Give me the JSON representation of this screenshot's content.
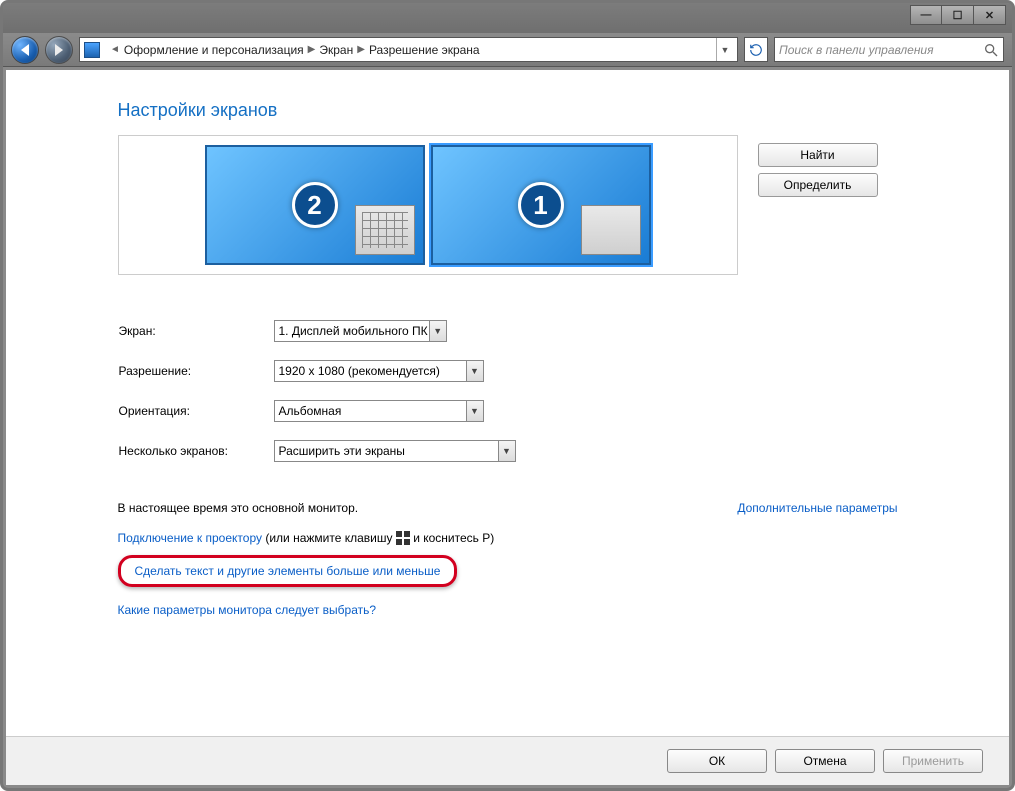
{
  "window": {
    "minimize": "—",
    "maximize": "☐",
    "close": "✕"
  },
  "nav": {
    "crumb1": "Оформление и персонализация",
    "crumb2": "Экран",
    "crumb3": "Разрешение экрана",
    "search_placeholder": "Поиск в панели управления"
  },
  "page": {
    "title": "Настройки экранов",
    "monitors": [
      {
        "number": "2",
        "selected": false
      },
      {
        "number": "1",
        "selected": true
      }
    ],
    "btn_detect": "Найти",
    "btn_identify": "Определить",
    "labels": {
      "display": "Экран:",
      "resolution": "Разрешение:",
      "orientation": "Ориентация:",
      "multi": "Несколько экранов:"
    },
    "values": {
      "display": "1. Дисплей мобильного ПК",
      "resolution": "1920 x 1080 (рекомендуется)",
      "orientation": "Альбомная",
      "multi": "Расширить эти экраны"
    },
    "main_status": "В настоящее время это основной монитор.",
    "adv_link": "Дополнительные параметры",
    "projector_link": "Подключение к проектору",
    "projector_hint_a": " (или нажмите клавишу ",
    "projector_hint_b": " и коснитесь P)",
    "resize_link": "Сделать текст и другие элементы больше или меньше",
    "which_link": "Какие параметры монитора следует выбрать?"
  },
  "footer": {
    "ok": "ОК",
    "cancel": "Отмена",
    "apply": "Применить"
  }
}
